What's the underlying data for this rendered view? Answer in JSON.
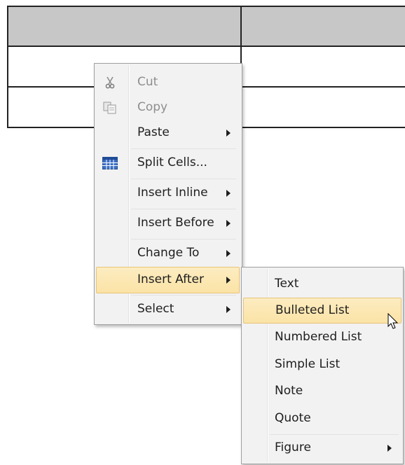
{
  "context_menu": {
    "items": [
      {
        "label": "Cut",
        "icon": "scissors-icon",
        "enabled": false,
        "submenu": false
      },
      {
        "label": "Copy",
        "icon": "copy-icon",
        "enabled": false,
        "submenu": false
      },
      {
        "label": "Paste",
        "icon": "",
        "enabled": true,
        "submenu": true
      },
      {
        "label": "Split Cells...",
        "icon": "table-grid-icon",
        "enabled": true,
        "submenu": false
      },
      {
        "label": "Insert Inline",
        "icon": "",
        "enabled": true,
        "submenu": true
      },
      {
        "label": "Insert Before",
        "icon": "",
        "enabled": true,
        "submenu": true
      },
      {
        "label": "Change To",
        "icon": "",
        "enabled": true,
        "submenu": true
      },
      {
        "label": "Insert After",
        "icon": "",
        "enabled": true,
        "submenu": true,
        "highlighted": true
      },
      {
        "label": "Select",
        "icon": "",
        "enabled": true,
        "submenu": true
      }
    ]
  },
  "submenu": {
    "parent": "Insert After",
    "items": [
      {
        "label": "Text",
        "submenu": false
      },
      {
        "label": "Bulleted List",
        "submenu": false,
        "highlighted": true
      },
      {
        "label": "Numbered List",
        "submenu": false
      },
      {
        "label": "Simple List",
        "submenu": false
      },
      {
        "label": "Note",
        "submenu": false
      },
      {
        "label": "Quote",
        "submenu": false
      },
      {
        "label": "Figure",
        "submenu": true
      }
    ]
  },
  "colors": {
    "highlight": "#fbe3a6",
    "highlight_border": "#e8c37a",
    "menu_bg": "#f2f2f2",
    "table_header": "#c7c7c7"
  }
}
